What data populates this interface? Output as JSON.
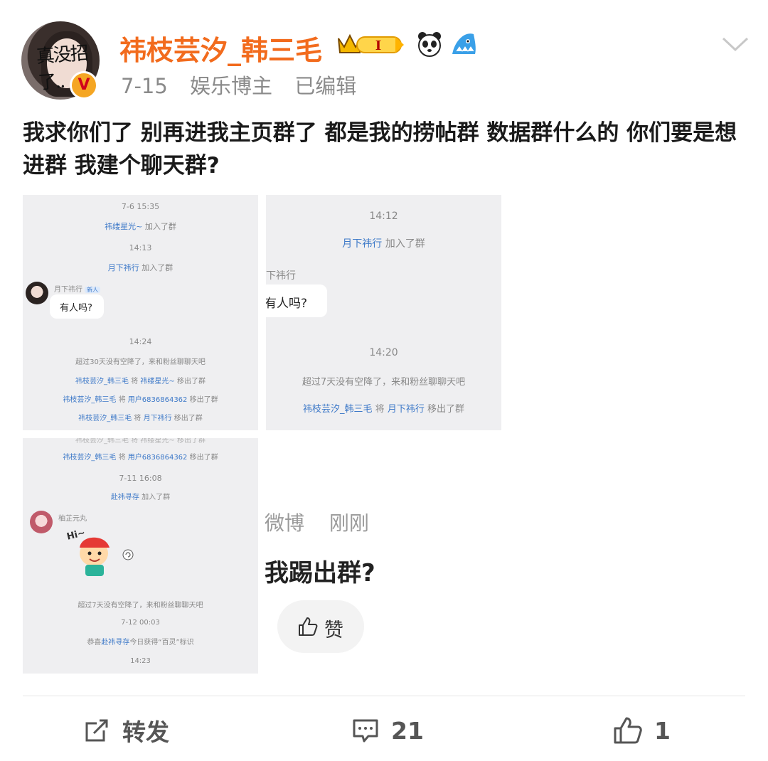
{
  "post": {
    "avatar_overlay_text": "真没招了..",
    "author_name": "祎枝芸汐_韩三毛",
    "level_badge": "I",
    "date": "7-15",
    "category": "娱乐博主",
    "edited": "已编辑",
    "text": "我求你们了 别再进我主页群了 都是我的捞帖群 数据群什么的 你们要是想进群 我建个聊天群?"
  },
  "images": {
    "img1": {
      "time1": "7-6 15:35",
      "join1_user": "祎缕星光~",
      "join1_action": "加入了群",
      "time2": "14:13",
      "join2_user": "月下祎行",
      "join2_action": "加入了群",
      "member_name": "月下祎行",
      "member_tag": "新人",
      "bubble": "有人吗?",
      "time3": "14:24",
      "notice": "超过30天没有空降了，来和粉丝聊聊天吧",
      "rm1_a": "祎枝芸汐_韩三毛",
      "rm1_b": "将",
      "rm1_c": "祎缕星光~",
      "rm1_d": "移出了群",
      "rm2_a": "祎枝芸汐_韩三毛",
      "rm2_b": "将",
      "rm2_c": "用户6836864362",
      "rm2_d": "移出了群",
      "rm3_a": "祎枝芸汐_韩三毛",
      "rm3_b": "将",
      "rm3_c": "月下祎行",
      "rm3_d": "移出了群"
    },
    "img2": {
      "time1": "14:12",
      "join_user": "月下祎行",
      "join_action": "加入了群",
      "member_name": "下祎行",
      "bubble": "有人吗?",
      "time2": "14:20",
      "notice": "超过7天没有空降了，来和粉丝聊聊天吧",
      "rm_a": "祎枝芸汐_韩三毛",
      "rm_b": "将",
      "rm_c": "月下祎行",
      "rm_d": "移出了群"
    },
    "img3": {
      "top_line": "祎枝芸汐_韩三毛 将 祎缕星光~ 移出了群",
      "rm_a": "祎枝芸汐_韩三毛",
      "rm_b": "将",
      "rm_c": "用户6836864362",
      "rm_d": "移出了群",
      "time1": "7-11 16:08",
      "join_user": "赴祎寻存",
      "join_action": "加入了群",
      "member_name": "柚芷元丸",
      "sticker_text": "Hi~",
      "notice": "超过7天没有空降了，来和粉丝聊聊天吧",
      "time2": "7-12 00:03",
      "award_pre": "恭喜",
      "award_user": "赴祎寻存",
      "award_post": "今日获得“百灵”标识",
      "time3": "14:23"
    }
  },
  "quoted": {
    "source": "微博",
    "time": "刚刚",
    "text": "我踢出群?",
    "like_label": "赞"
  },
  "actions": {
    "forward_label": "转发",
    "comment_count": "21",
    "like_count": "1"
  },
  "colors": {
    "author": "#f26b1d",
    "link_blue": "#3c78c8",
    "meta_gray": "#8a8a8a"
  }
}
